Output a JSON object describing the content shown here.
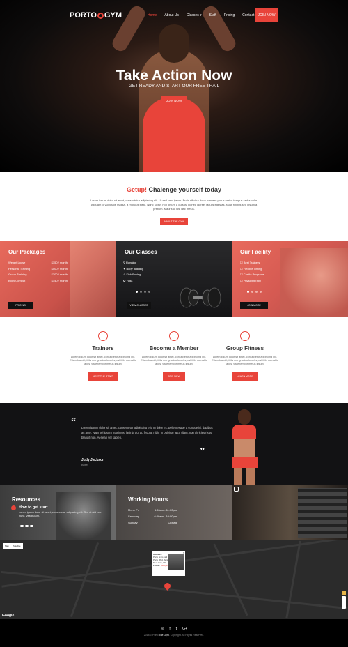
{
  "header": {
    "logo_left": "PORTO",
    "logo_right": "GYM",
    "nav": [
      {
        "label": "Home"
      },
      {
        "label": "About Us"
      },
      {
        "label": "Classes ▾"
      },
      {
        "label": "Staff"
      },
      {
        "label": "Pricing"
      },
      {
        "label": "Contact Us"
      }
    ],
    "join_label": "JOIN NOW"
  },
  "hero": {
    "title": "Take Action Now",
    "subtitle": "GET READY AND START OUR FREE TRAIL",
    "button": "JOIN NOW"
  },
  "intro": {
    "title_accent": "Getup!",
    "title_rest": " Chalenge yourself today",
    "text": "Lorem ipsum dolor sit amet, consectetur adipiscing elit. Ut sed sem ipsum. Proin efficitur dolor posuere purus varius tempus sed a nulla. Aliquam id vulputate massa, a rhoncus justo. Nunc luctus non ipsum a cursus. Donec laoreet iaculis egestas. Nulla finibus sed ipsum a pretium. Mauris ut nisl nec metus.",
    "button": "ABOUT THE GYM"
  },
  "packages": {
    "title": "Our Packages",
    "items": [
      {
        "name": "Weight Loose",
        "price": "$150 / month"
      },
      {
        "name": "Personal Training",
        "price": "$500 / month"
      },
      {
        "name": "Group Training",
        "price": "$300 / month"
      },
      {
        "name": "Body Combat",
        "price": "$140 / month"
      }
    ],
    "button": "PRICING"
  },
  "classes": {
    "title": "Our Classes",
    "items": [
      "Running",
      "Body Building",
      "Kick Boxing",
      "Yoga"
    ],
    "button": "VIEW CLASSES"
  },
  "facility": {
    "title": "Our Facility",
    "items": [
      "Best Trainers",
      "Flexible Timing",
      "Cardio Programs",
      "Physiotherapy"
    ],
    "button": "JOIN MORE"
  },
  "features": [
    {
      "title": "Trainers",
      "text": "Lorem ipsum dolor sit amet, consectetur adipiscing elit. Etiam blandit, felis nec gravida lobortis, est felis convallis lacus, vitae tempor metus ipsum.",
      "button": "MEET THE STAFF"
    },
    {
      "title": "Become a Member",
      "text": "Lorem ipsum dolor sit amet, consectetur adipiscing elit. Etiam blandit, felis nec gravida lobortis, est felis convallis lacus, vitae tempor metus ipsum.",
      "button": "JOIN NOW"
    },
    {
      "title": "Group Fitness",
      "text": "Lorem ipsum dolor sit amet, consectetur adipiscing elit. Etiam blandit, felis nec gravida lobortis, est felis convallis lacus, vitae tempor metus ipsum.",
      "button": "LEARN MORE"
    }
  ],
  "testimonial": {
    "text": "Lorem ipsum dolor sit amet, consectetur adipiscing elit. In dolor ex, pellentesque a congue id, dapibus ac ante. Nam vel ipsum maximus, lacinia dui at, feugiat nibh. In pulvinar arcu diam, non ultricies risus blandit non. Aenean vel sapien.",
    "name": "Judy Jackson",
    "role": "Boxer"
  },
  "resources": {
    "title": "Resources",
    "item_title": "How to get start",
    "item_text": "Lorem ipsum dolor sit amet, consectetur adipiscing elit. Sed ut nisl nec nunc. Vestibulum."
  },
  "hours": {
    "title": "Working Hours",
    "rows": [
      {
        "day": "Mon - Fri",
        "time": "5:00am - 11:00pm"
      },
      {
        "day": "Saturday",
        "time": "6:00am - 10:00pm"
      },
      {
        "day": "Sunday",
        "time": "Closed"
      }
    ]
  },
  "map": {
    "map_label": "Map",
    "satellite_label": "Satellite",
    "info_title": "Address:",
    "info_lines": [
      "Porto Gym 123",
      "Porto Blvd, Suite 100",
      "New York, NY"
    ],
    "info_phone_label": "Phone:",
    "info_phone": "(800) 123-4567",
    "google": "Google"
  },
  "footer": {
    "social": [
      "◎",
      "f",
      "t",
      "G+"
    ],
    "copy_prefix": "2018 © Porto ",
    "copy_brand": "The Gym",
    "copy_suffix": ". Copyright. All Rights Reserved."
  },
  "colors": {
    "accent": "#e8443a",
    "dark": "#121214"
  }
}
